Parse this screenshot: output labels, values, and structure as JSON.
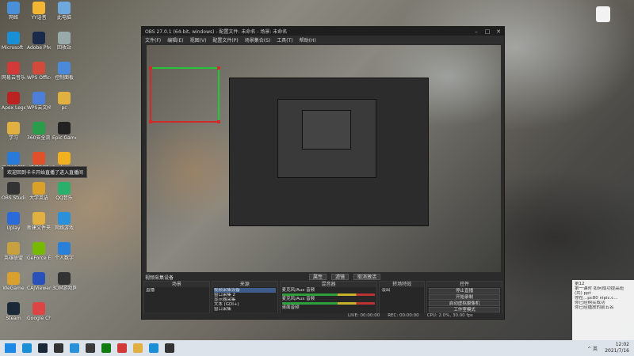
{
  "desktop": {
    "icons": [
      {
        "label": "网络",
        "color": "#4a90d9"
      },
      {
        "label": "YY语音",
        "color": "#f2b632"
      },
      {
        "label": "此电脑",
        "color": "#6fa8dc"
      },
      {
        "label": "Microsoft Edge",
        "color": "#1b8fd6"
      },
      {
        "label": "Adobe Photoshop",
        "color": "#1b2a4a"
      },
      {
        "label": "回收站",
        "color": "#9aa"
      },
      {
        "label": "网易云音乐",
        "color": "#d23a3a"
      },
      {
        "label": "WPS Office",
        "color": "#d24b3a"
      },
      {
        "label": "控制面板",
        "color": "#4a8ad9"
      },
      {
        "label": "Apex Legends",
        "color": "#b22"
      },
      {
        "label": "WPS云文档",
        "color": "#4b7fd9"
      },
      {
        "label": "pc",
        "color": "#e0b040"
      },
      {
        "label": "学习",
        "color": "#e0b040"
      },
      {
        "label": "360安全浏览器",
        "color": "#2a9d4a"
      },
      {
        "label": "Epic Games",
        "color": "#222"
      },
      {
        "label": "迅捷PDF转换",
        "color": "#2a7ad9"
      },
      {
        "label": "腾讯视频",
        "color": "#e0502a"
      },
      {
        "label": "Rockstar Games",
        "color": "#f0b020"
      },
      {
        "label": "OBS Studio",
        "color": "#333"
      },
      {
        "label": "大学英语",
        "color": "#d9a02a"
      },
      {
        "label": "QQ音乐",
        "color": "#2ab06a"
      },
      {
        "label": "Uplay",
        "color": "#2a6ad9"
      },
      {
        "label": "新建文件夹",
        "color": "#e0b040"
      },
      {
        "label": "网络游戏",
        "color": "#2a90d9"
      },
      {
        "label": "英雄联盟",
        "color": "#c8a040"
      },
      {
        "label": "GeForce Experience",
        "color": "#76b900"
      },
      {
        "label": "个人数字",
        "color": "#2a80d9"
      },
      {
        "label": "WeGame",
        "color": "#d9a030"
      },
      {
        "label": "CAJViewer 7.3",
        "color": "#2a50b9"
      },
      {
        "label": "3DM游戏网",
        "color": "#333"
      },
      {
        "label": "Steam",
        "color": "#1b2838"
      },
      {
        "label": "Google Chrome",
        "color": "#d44"
      }
    ],
    "tooltip": "欢迎回到卡卡开始直播了进入直播间"
  },
  "obs": {
    "title": "OBS 27.0.1 (64-bit, windows) - 配置文件: 未命名 - 场景: 未命名",
    "menu": [
      "文件(F)",
      "编辑(E)",
      "视图(V)",
      "配置文件(P)",
      "场景集合(S)",
      "工具(T)",
      "帮助(H)"
    ],
    "source_bar": {
      "name": "视频采集设备",
      "props": "属性",
      "filters": "滤镜",
      "action": "取消激活"
    },
    "docks": {
      "scenes": {
        "title": "场景",
        "items": [
          "直播"
        ]
      },
      "sources": {
        "title": "来源",
        "items": [
          "视频采集设备",
          "窗口采集 2",
          "显示器采集",
          "文本 (GDI+)",
          "窗口采集",
          "窗口采集"
        ]
      },
      "mixer": {
        "title": "混音器",
        "channels": [
          {
            "name": "麦克风/Aux 音频",
            "level": "0.0 dB"
          },
          {
            "name": "麦克风/Aux 音频",
            "level": "0.0 dB"
          },
          {
            "name": "桌面音频",
            "level": "0.0 dB"
          }
        ]
      },
      "transitions": {
        "title": "转场特效",
        "value": "淡出",
        "duration_label": "时长",
        "duration": "300 ms"
      },
      "controls": {
        "title": "控件",
        "buttons": [
          "停止直播",
          "开始录制",
          "启动虚拟摄像机",
          "工作室模式",
          "设置",
          "退出"
        ]
      }
    },
    "status": {
      "live": "LIVE: 00:00:00",
      "rec": "REC: 00:00:00",
      "cpu": "CPU: 2.0%, 30.00 fps"
    }
  },
  "notifications": {
    "items": [
      "第12",
      "第一课时 如何成功提高班",
      "(共) ppt",
      "你在...pc80 nipic.c...",
      "你已经购买成功",
      "你已经播放的前五名"
    ]
  },
  "taskbar": {
    "time": "12:02",
    "date": "2021/7/16",
    "tray": "^ 英"
  }
}
